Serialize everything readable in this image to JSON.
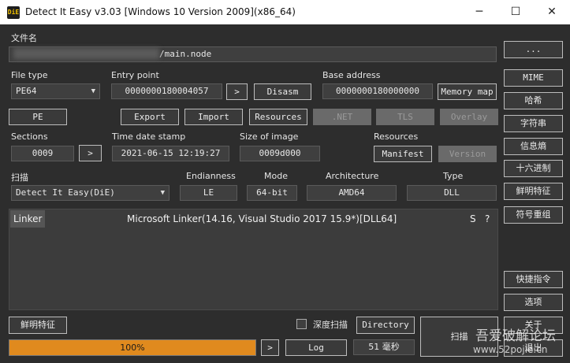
{
  "window": {
    "title": "Detect It Easy v3.03 [Windows 10 Version 2009](x86_64)",
    "app_icon_text": "DiE",
    "minimize": "─",
    "maximize": "☐",
    "close": "✕"
  },
  "file": {
    "label": "文件名",
    "path": "/main.node",
    "browse": "..."
  },
  "file_type": {
    "label": "File type",
    "value": "PE64"
  },
  "entry_point": {
    "label": "Entry point",
    "value": "0000000180004057",
    "go": ">",
    "disasm": "Disasm"
  },
  "base_address": {
    "label": "Base address",
    "value": "0000000180000000",
    "memory_map": "Memory map"
  },
  "buttons": {
    "pe": "PE",
    "export": "Export",
    "import": "Import",
    "resources": "Resources",
    "net": ".NET",
    "tls": "TLS",
    "overlay": "Overlay",
    "manifest": "Manifest",
    "version": "Version"
  },
  "sections": {
    "label": "Sections",
    "value": "0009",
    "go": ">"
  },
  "timestamp": {
    "label": "Time date stamp",
    "value": "2021-06-15 12:19:27"
  },
  "size_of_image": {
    "label": "Size of image",
    "value": "0009d000"
  },
  "resources_label": "Resources",
  "scan": {
    "label": "扫描",
    "engine": "Detect It Easy(DiE)",
    "endianness_label": "Endianness",
    "endianness": "LE",
    "mode_label": "Mode",
    "mode": "64-bit",
    "arch_label": "Architecture",
    "arch": "AMD64",
    "type_label": "Type",
    "type": "DLL"
  },
  "results": [
    {
      "type": "Linker",
      "value": "Microsoft Linker(14.16, Visual Studio 2017 15.9*)[DLL64]",
      "s": "S",
      "q": "?"
    }
  ],
  "sidebar": {
    "mime": "MIME",
    "hash": "哈希",
    "strings": "字符串",
    "entropy": "信息熵",
    "hex": "十六进制",
    "signatures": "鲜明特征",
    "demangle": "符号重组",
    "shortcuts": "快捷指令",
    "options": "选项",
    "about": "关于",
    "exit": "退出"
  },
  "bottom": {
    "signatures": "鲜明特征",
    "deep_scan": "深度扫描",
    "directory": "Directory",
    "scan": "扫描",
    "progress": 100,
    "progress_text": "100%",
    "go": ">",
    "log": "Log",
    "elapsed": "51 毫秒"
  },
  "watermark": {
    "line1": "吾爱破解论坛",
    "line2": "www.52pojie.cn"
  }
}
